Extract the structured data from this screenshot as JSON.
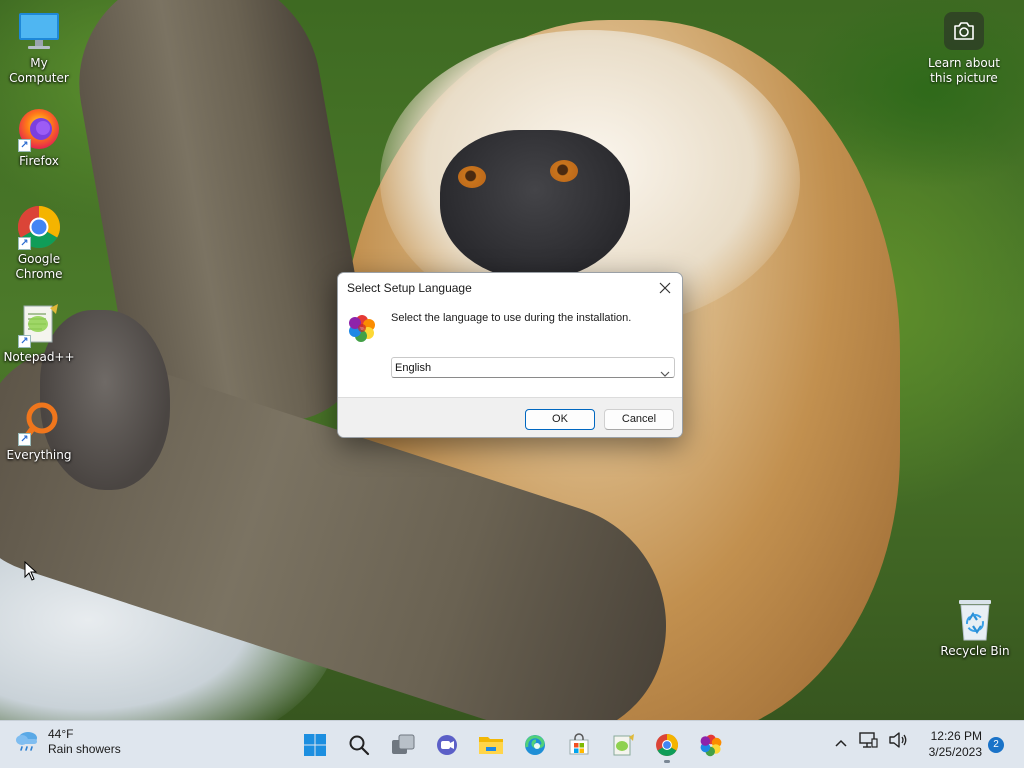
{
  "desktop": {
    "icons": [
      {
        "label": "My Computer",
        "icon": "monitor-icon"
      },
      {
        "label": "Firefox",
        "icon": "firefox-icon"
      },
      {
        "label": "Google\nChrome",
        "icon": "chrome-icon"
      },
      {
        "label": "Notepad++",
        "icon": "notepadpp-icon"
      },
      {
        "label": "Everything",
        "icon": "everything-search-icon"
      },
      {
        "label": "Recycle Bin",
        "icon": "recycle-bin-icon"
      }
    ],
    "learn_picture": {
      "label": "Learn about\nthis picture",
      "icon": "camera-icon"
    }
  },
  "dialog": {
    "title": "Select Setup Language",
    "message": "Select the language to use during the installation.",
    "language_selected": "English",
    "ok_label": "OK",
    "cancel_label": "Cancel"
  },
  "taskbar": {
    "weather": {
      "temp": "44°F",
      "condition": "Rain showers"
    },
    "apps": [
      "start-icon",
      "search-icon",
      "task-view-icon",
      "chat-icon",
      "file-explorer-icon",
      "edge-icon",
      "store-icon",
      "notepadpp-icon",
      "chrome-icon",
      "setup-icon"
    ],
    "clock": {
      "time": "12:26 PM",
      "date": "3/25/2023"
    },
    "notifications": "2"
  },
  "colors": {
    "accent": "#0067c0",
    "taskbar_bg": "#dfe6ee",
    "dialog_bg": "#f0f0f0"
  }
}
